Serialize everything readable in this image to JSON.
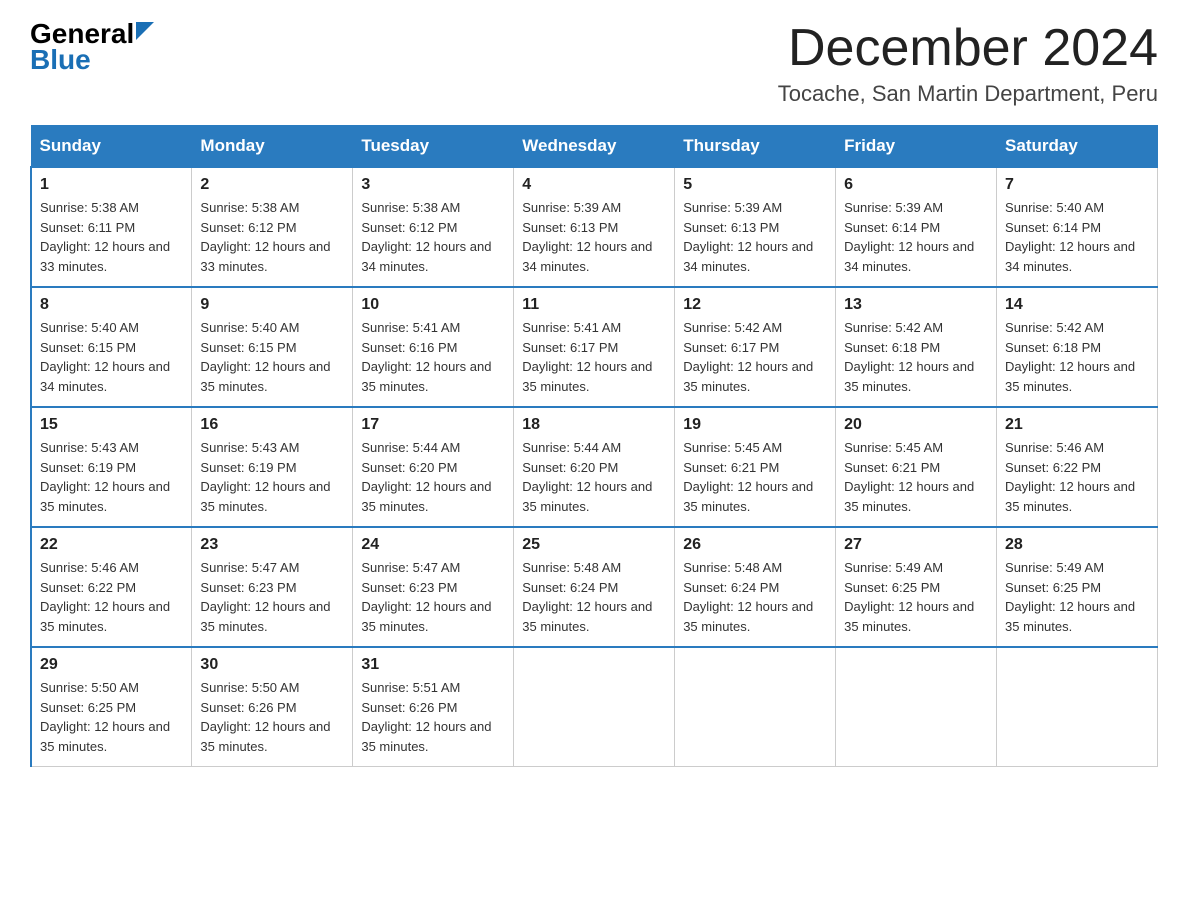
{
  "header": {
    "logo_general": "General",
    "logo_blue": "Blue",
    "month_title": "December 2024",
    "location": "Tocache, San Martin Department, Peru"
  },
  "days_of_week": [
    "Sunday",
    "Monday",
    "Tuesday",
    "Wednesday",
    "Thursday",
    "Friday",
    "Saturday"
  ],
  "weeks": [
    [
      {
        "day": "1",
        "sunrise": "5:38 AM",
        "sunset": "6:11 PM",
        "daylight": "12 hours and 33 minutes."
      },
      {
        "day": "2",
        "sunrise": "5:38 AM",
        "sunset": "6:12 PM",
        "daylight": "12 hours and 33 minutes."
      },
      {
        "day": "3",
        "sunrise": "5:38 AM",
        "sunset": "6:12 PM",
        "daylight": "12 hours and 34 minutes."
      },
      {
        "day": "4",
        "sunrise": "5:39 AM",
        "sunset": "6:13 PM",
        "daylight": "12 hours and 34 minutes."
      },
      {
        "day": "5",
        "sunrise": "5:39 AM",
        "sunset": "6:13 PM",
        "daylight": "12 hours and 34 minutes."
      },
      {
        "day": "6",
        "sunrise": "5:39 AM",
        "sunset": "6:14 PM",
        "daylight": "12 hours and 34 minutes."
      },
      {
        "day": "7",
        "sunrise": "5:40 AM",
        "sunset": "6:14 PM",
        "daylight": "12 hours and 34 minutes."
      }
    ],
    [
      {
        "day": "8",
        "sunrise": "5:40 AM",
        "sunset": "6:15 PM",
        "daylight": "12 hours and 34 minutes."
      },
      {
        "day": "9",
        "sunrise": "5:40 AM",
        "sunset": "6:15 PM",
        "daylight": "12 hours and 35 minutes."
      },
      {
        "day": "10",
        "sunrise": "5:41 AM",
        "sunset": "6:16 PM",
        "daylight": "12 hours and 35 minutes."
      },
      {
        "day": "11",
        "sunrise": "5:41 AM",
        "sunset": "6:17 PM",
        "daylight": "12 hours and 35 minutes."
      },
      {
        "day": "12",
        "sunrise": "5:42 AM",
        "sunset": "6:17 PM",
        "daylight": "12 hours and 35 minutes."
      },
      {
        "day": "13",
        "sunrise": "5:42 AM",
        "sunset": "6:18 PM",
        "daylight": "12 hours and 35 minutes."
      },
      {
        "day": "14",
        "sunrise": "5:42 AM",
        "sunset": "6:18 PM",
        "daylight": "12 hours and 35 minutes."
      }
    ],
    [
      {
        "day": "15",
        "sunrise": "5:43 AM",
        "sunset": "6:19 PM",
        "daylight": "12 hours and 35 minutes."
      },
      {
        "day": "16",
        "sunrise": "5:43 AM",
        "sunset": "6:19 PM",
        "daylight": "12 hours and 35 minutes."
      },
      {
        "day": "17",
        "sunrise": "5:44 AM",
        "sunset": "6:20 PM",
        "daylight": "12 hours and 35 minutes."
      },
      {
        "day": "18",
        "sunrise": "5:44 AM",
        "sunset": "6:20 PM",
        "daylight": "12 hours and 35 minutes."
      },
      {
        "day": "19",
        "sunrise": "5:45 AM",
        "sunset": "6:21 PM",
        "daylight": "12 hours and 35 minutes."
      },
      {
        "day": "20",
        "sunrise": "5:45 AM",
        "sunset": "6:21 PM",
        "daylight": "12 hours and 35 minutes."
      },
      {
        "day": "21",
        "sunrise": "5:46 AM",
        "sunset": "6:22 PM",
        "daylight": "12 hours and 35 minutes."
      }
    ],
    [
      {
        "day": "22",
        "sunrise": "5:46 AM",
        "sunset": "6:22 PM",
        "daylight": "12 hours and 35 minutes."
      },
      {
        "day": "23",
        "sunrise": "5:47 AM",
        "sunset": "6:23 PM",
        "daylight": "12 hours and 35 minutes."
      },
      {
        "day": "24",
        "sunrise": "5:47 AM",
        "sunset": "6:23 PM",
        "daylight": "12 hours and 35 minutes."
      },
      {
        "day": "25",
        "sunrise": "5:48 AM",
        "sunset": "6:24 PM",
        "daylight": "12 hours and 35 minutes."
      },
      {
        "day": "26",
        "sunrise": "5:48 AM",
        "sunset": "6:24 PM",
        "daylight": "12 hours and 35 minutes."
      },
      {
        "day": "27",
        "sunrise": "5:49 AM",
        "sunset": "6:25 PM",
        "daylight": "12 hours and 35 minutes."
      },
      {
        "day": "28",
        "sunrise": "5:49 AM",
        "sunset": "6:25 PM",
        "daylight": "12 hours and 35 minutes."
      }
    ],
    [
      {
        "day": "29",
        "sunrise": "5:50 AM",
        "sunset": "6:25 PM",
        "daylight": "12 hours and 35 minutes."
      },
      {
        "day": "30",
        "sunrise": "5:50 AM",
        "sunset": "6:26 PM",
        "daylight": "12 hours and 35 minutes."
      },
      {
        "day": "31",
        "sunrise": "5:51 AM",
        "sunset": "6:26 PM",
        "daylight": "12 hours and 35 minutes."
      },
      null,
      null,
      null,
      null
    ]
  ]
}
